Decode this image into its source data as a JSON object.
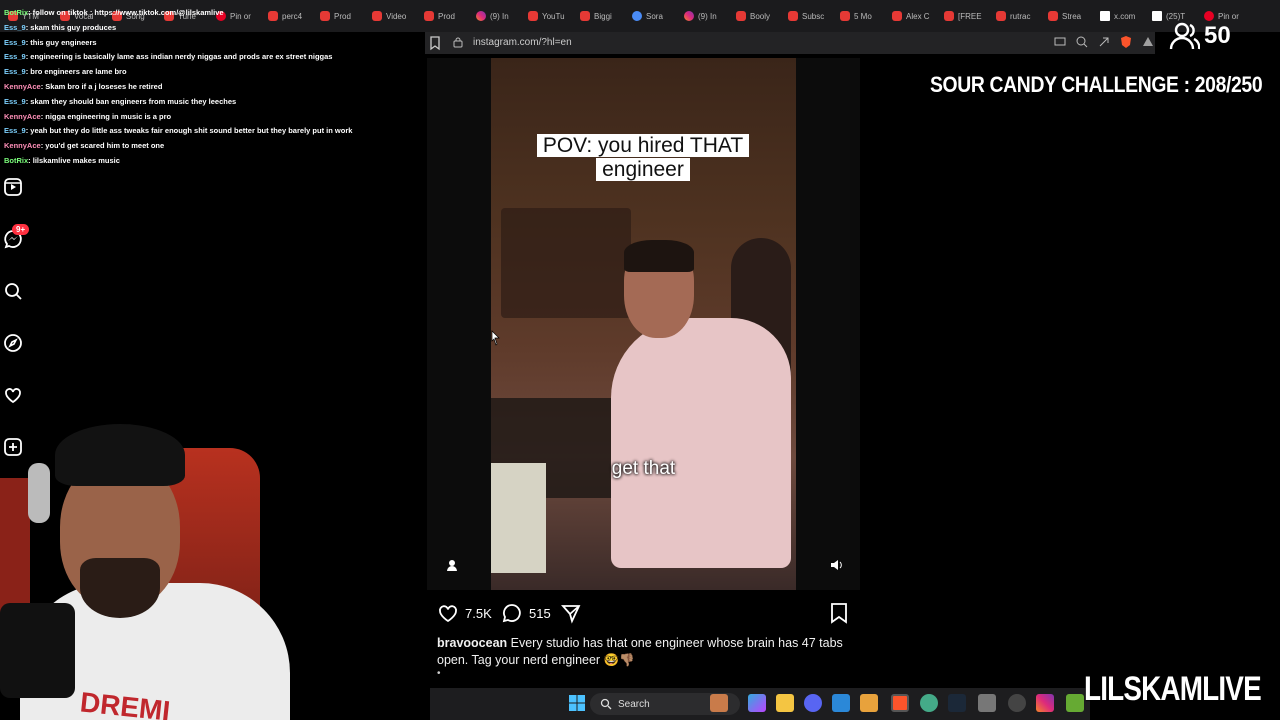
{
  "tabs": [
    {
      "label": "YTM",
      "icon": "youtube"
    },
    {
      "label": "Vocal",
      "icon": "youtube"
    },
    {
      "label": "Song",
      "icon": "youtube"
    },
    {
      "label": "Tune",
      "icon": "youtube"
    },
    {
      "label": "Pin or",
      "icon": "pinterest"
    },
    {
      "label": "perc4",
      "icon": "youtube"
    },
    {
      "label": "Prod",
      "icon": "youtube"
    },
    {
      "label": "Video",
      "icon": "youtube"
    },
    {
      "label": "Prod",
      "icon": "youtube"
    },
    {
      "label": "(9) In",
      "icon": "instagram"
    },
    {
      "label": "YouTu",
      "icon": "youtube"
    },
    {
      "label": "Biggi",
      "icon": "youtube"
    },
    {
      "label": "Sora",
      "icon": "chatgpt"
    },
    {
      "label": "(9) In",
      "icon": "instagram"
    },
    {
      "label": "Booly",
      "icon": "youtube"
    },
    {
      "label": "Subsc",
      "icon": "youtube"
    },
    {
      "label": "5 Mo",
      "icon": "youtube"
    },
    {
      "label": "Alex C",
      "icon": "youtube"
    },
    {
      "label": "[FREE",
      "icon": "youtube"
    },
    {
      "label": "rutrac",
      "icon": "youtube"
    },
    {
      "label": "Strea",
      "icon": "youtube"
    },
    {
      "label": "x.com",
      "icon": "x"
    },
    {
      "label": "(25)T",
      "icon": "tiktok"
    },
    {
      "label": "Pin or",
      "icon": "pinterest"
    }
  ],
  "address": {
    "url": "instagram.com/?hl=en"
  },
  "chat": [
    {
      "user": "BotRix",
      "type": "bot",
      "msg": ": follow on tiktok : https://www.tiktok.com/@lilskamlive"
    },
    {
      "user": "Ess_9",
      "type": "user",
      "msg": ": skam this guy produces"
    },
    {
      "user": "Ess_9",
      "type": "user",
      "msg": ": this guy engineers"
    },
    {
      "user": "Ess_9",
      "type": "user",
      "msg": ": engineering is basically lame ass indian nerdy niggas and prods are ex street niggas"
    },
    {
      "user": "Ess_9",
      "type": "user",
      "msg": ": bro engineers are lame bro"
    },
    {
      "user": "KennyAce",
      "type": "pink",
      "msg": ": Skam bro if a j loseses he retired"
    },
    {
      "user": "Ess_9",
      "type": "user",
      "msg": ": skam they should ban engineers from music they leeches"
    },
    {
      "user": "KennyAce",
      "type": "pink",
      "msg": ": nigga engineering in music is a pro"
    },
    {
      "user": "Ess_9",
      "type": "user",
      "msg": ": yeah but they do little ass tweaks fair enough shit sound better but they barely put in work"
    },
    {
      "user": "KennyAce",
      "type": "pink",
      "msg": ": you'd get scared him to meet one"
    },
    {
      "user": "BotRix",
      "type": "bot",
      "msg": ": lilskamlive makes music"
    }
  ],
  "sidebar": {
    "badge": "9+"
  },
  "post": {
    "pov_text": "POV: you hired THAT engineer",
    "subtitle": "get that",
    "likes": "7.5K",
    "comments": "515",
    "caption_user": "bravoocean",
    "caption_text": " Every studio has that one engineer whose brain has 47 tabs open. Tag your nerd engineer 🤓👎🏽",
    "more": "•"
  },
  "overlay": {
    "challenge": "SOUR CANDY CHALLENGE : 208/250",
    "viewers": "50",
    "brand": "LILSKAMLIVE"
  },
  "taskbar": {
    "search_label": "Search"
  },
  "webcam": {
    "shirt_text": "DREMI"
  }
}
